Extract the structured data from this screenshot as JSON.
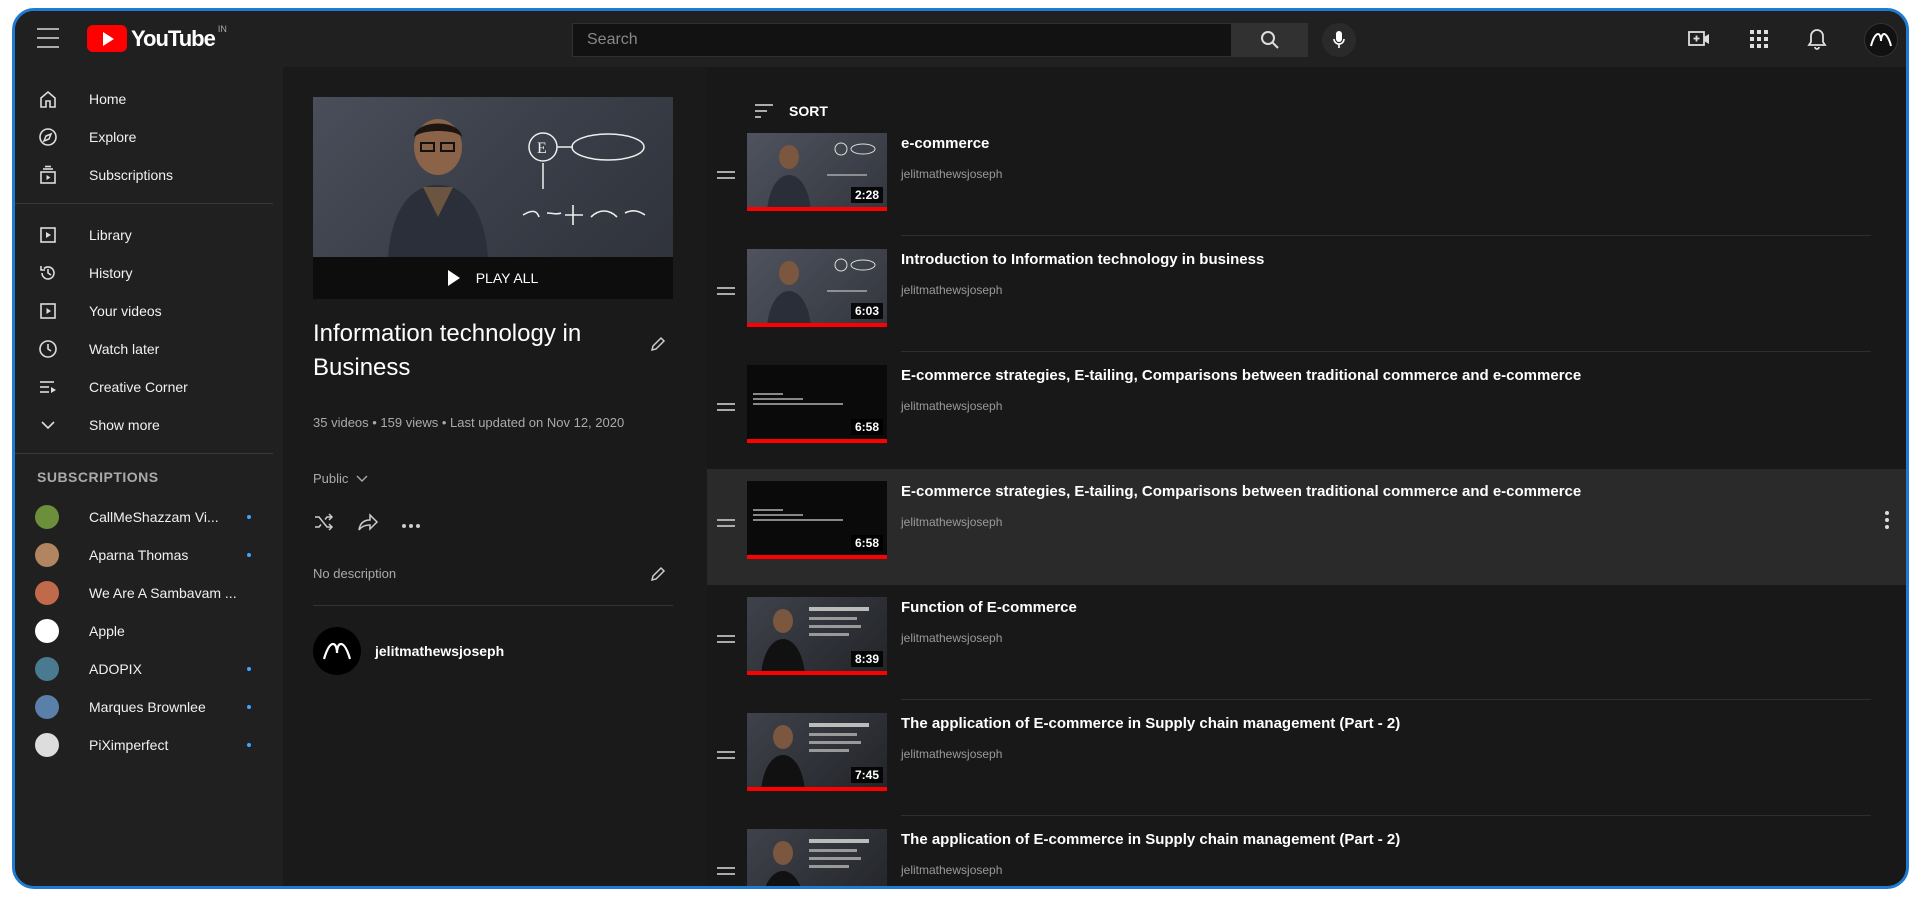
{
  "header": {
    "logo_text": "YouTube",
    "logo_sup": "IN",
    "search_placeholder": "Search",
    "icons": [
      "menu-icon",
      "search-icon",
      "mic-icon",
      "create-video-icon",
      "apps-icon",
      "bell-icon",
      "account-avatar"
    ]
  },
  "sidebar": {
    "main": [
      {
        "label": "Home",
        "icon": "home-icon"
      },
      {
        "label": "Explore",
        "icon": "compass-icon"
      },
      {
        "label": "Subscriptions",
        "icon": "subscriptions-icon"
      }
    ],
    "library": [
      {
        "label": "Library",
        "icon": "library-icon"
      },
      {
        "label": "History",
        "icon": "history-icon"
      },
      {
        "label": "Your videos",
        "icon": "your-videos-icon"
      },
      {
        "label": "Watch later",
        "icon": "clock-icon"
      },
      {
        "label": "Creative Corner",
        "icon": "playlist-icon"
      },
      {
        "label": "Show more",
        "icon": "chevron-down-icon"
      }
    ],
    "subscriptions_heading": "SUBSCRIPTIONS",
    "subscriptions": [
      {
        "label": "CallMeShazzam Vi...",
        "new": true,
        "color": "#6b8f3a"
      },
      {
        "label": "Aparna Thomas",
        "new": true,
        "color": "#b08560"
      },
      {
        "label": "We Are A Sambavam ...",
        "new": false,
        "color": "#c06a4a"
      },
      {
        "label": "Apple",
        "new": false,
        "color": "#ffffff"
      },
      {
        "label": "ADOPIX",
        "new": true,
        "color": "#4a7a90"
      },
      {
        "label": "Marques Brownlee",
        "new": true,
        "color": "#5a7fa8"
      },
      {
        "label": "PiXimperfect",
        "new": true,
        "color": "#dddddd"
      }
    ]
  },
  "playlist": {
    "play_all": "PLAY ALL",
    "title": "Information technology in Business",
    "meta": "35 videos • 159 views • Last updated on Nov 12, 2020",
    "privacy": "Public",
    "description": "No description",
    "owner": "jelitmathewsjoseph"
  },
  "list": {
    "sort_label": "SORT",
    "videos": [
      {
        "title": "e-commerce",
        "channel": "jelitmathewsjoseph",
        "duration": "2:28",
        "thumb": "person"
      },
      {
        "title": "Introduction to Information technology in business",
        "channel": "jelitmathewsjoseph",
        "duration": "6:03",
        "thumb": "person"
      },
      {
        "title": "E-commerce strategies, E-tailing, Comparisons between traditional commerce and e-commerce",
        "channel": "jelitmathewsjoseph",
        "duration": "6:58",
        "thumb": "dark"
      },
      {
        "title": "E-commerce strategies, E-tailing, Comparisons between traditional commerce and e-commerce",
        "channel": "jelitmathewsjoseph",
        "duration": "6:58",
        "thumb": "dark"
      },
      {
        "title": "Function of E-commerce",
        "channel": "jelitmathewsjoseph",
        "duration": "8:39",
        "thumb": "stage"
      },
      {
        "title": "The application of E-commerce in Supply chain management (Part - 2)",
        "channel": "jelitmathewsjoseph",
        "duration": "7:45",
        "thumb": "stage"
      },
      {
        "title": "The application of E-commerce in Supply chain management (Part - 2)",
        "channel": "jelitmathewsjoseph",
        "duration": "",
        "thumb": "stage"
      }
    ]
  }
}
